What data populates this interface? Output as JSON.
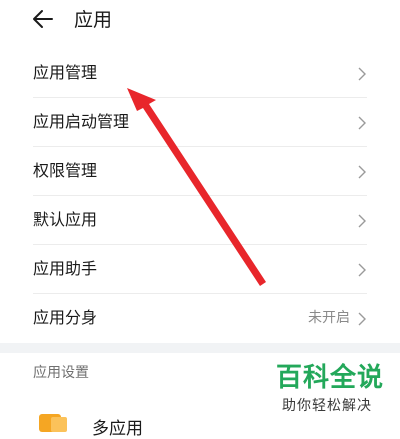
{
  "header": {
    "title": "应用"
  },
  "items": [
    {
      "label": "应用管理",
      "value": ""
    },
    {
      "label": "应用启动管理",
      "value": ""
    },
    {
      "label": "权限管理",
      "value": ""
    },
    {
      "label": "默认应用",
      "value": ""
    },
    {
      "label": "应用助手",
      "value": ""
    },
    {
      "label": "应用分身",
      "value": "未开启"
    }
  ],
  "section": {
    "title": "应用设置",
    "partial_item": "多应用"
  },
  "watermark": {
    "main": "百科全说",
    "sub": "助你轻松解决"
  },
  "colors": {
    "arrow": "#e8262b",
    "watermark": "#23a85a",
    "band": "#f1f3f5"
  }
}
